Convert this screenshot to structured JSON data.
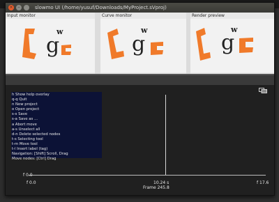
{
  "window": {
    "title": "slowmo UI (/home/yusuf/Downloads/MyProject.sVproj)"
  },
  "panels": {
    "input_monitor": "Input monitor",
    "curve_monitor": "Curve monitor",
    "render_preview": "Render preview"
  },
  "help": {
    "lines": [
      "h Show help overlay",
      "q-q Quit",
      "n New project",
      "o Open project",
      "s-s Save",
      "s-a Save as ...",
      "a Abort move",
      "a-s Unselect all",
      "d-n Delete selected nodes",
      "t-s Selecting tool",
      "t-m Move tool",
      "t-l Insert label (tag)",
      "Navigation: [Shift] Scroll, Drag",
      "Move nodes: [Ctrl]  Drag"
    ]
  },
  "timeline": {
    "y_min_label": "f 0.0",
    "x_start_label": "f 0.0",
    "x_end_label": "f 17.6",
    "cursor_time": "10.24 s",
    "frame": "Frame 245.8"
  },
  "colors": {
    "accent_orange": "#f07a2a",
    "help_bg": "#0c1236"
  },
  "icons": {
    "close": "close-icon",
    "minimize": "minimize-icon",
    "maximize": "maximize-icon",
    "timeline_tool": "display-mode-icon"
  }
}
